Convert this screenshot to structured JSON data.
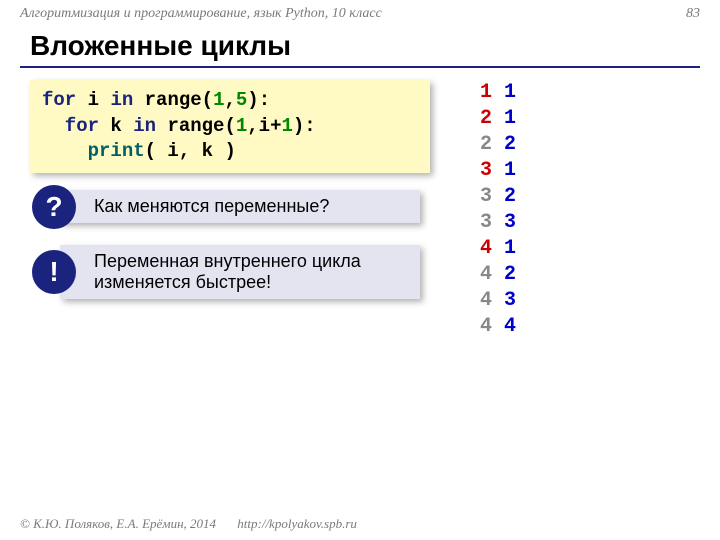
{
  "header": {
    "course": "Алгоритмизация и программирование, язык Python, 10 класс",
    "page": "83"
  },
  "title": "Вложенные циклы",
  "code": {
    "l1a": "for",
    "l1b": " i ",
    "l1c": "in",
    "l1d": " range(",
    "l1e": "1",
    "l1f": ",",
    "l1g": "5",
    "l1h": "):",
    "l2a": "  for",
    "l2b": " k ",
    "l2c": "in",
    "l2d": " range(",
    "l2e": "1",
    "l2f": ",i+",
    "l2g": "1",
    "l2h": "):",
    "l3a": "    print",
    "l3b": "( i, k )"
  },
  "callouts": {
    "q_badge": "?",
    "q_text": "Как меняются переменные?",
    "e_badge": "!",
    "e_text": "Переменная внутреннего цикла изменяется быстрее!"
  },
  "output": [
    {
      "i": "1",
      "k": "1",
      "first": true
    },
    {
      "i": "2",
      "k": "1",
      "first": true
    },
    {
      "i": "2",
      "k": "2",
      "first": false
    },
    {
      "i": "3",
      "k": "1",
      "first": true
    },
    {
      "i": "3",
      "k": "2",
      "first": false
    },
    {
      "i": "3",
      "k": "3",
      "first": false
    },
    {
      "i": "4",
      "k": "1",
      "first": true
    },
    {
      "i": "4",
      "k": "2",
      "first": false
    },
    {
      "i": "4",
      "k": "3",
      "first": false
    },
    {
      "i": "4",
      "k": "4",
      "first": false
    }
  ],
  "footer": {
    "copy": "© К.Ю. Поляков, Е.А. Ерёмин, 2014",
    "url": "http://kpolyakov.spb.ru"
  }
}
